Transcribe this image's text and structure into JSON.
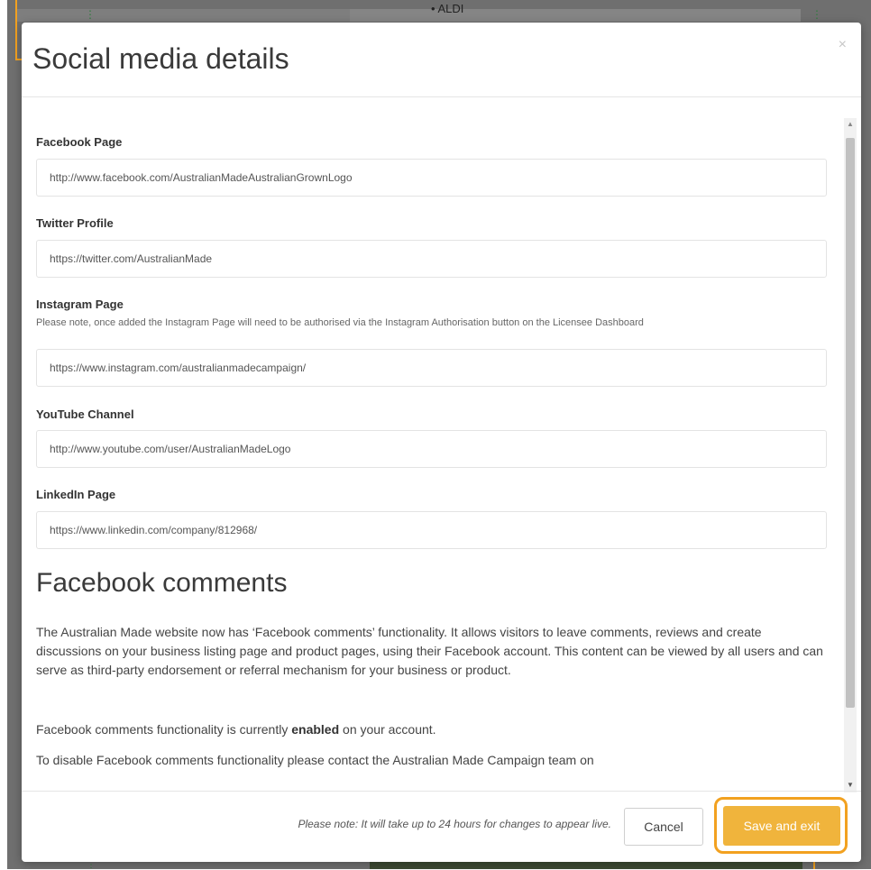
{
  "background": {
    "list_item": "ALDI"
  },
  "modal": {
    "title": "Social media details",
    "close_symbol": "×"
  },
  "fields": [
    {
      "label": "Facebook Page",
      "value": "http://www.facebook.com/AustralianMadeAustralianGrownLogo"
    },
    {
      "label": "Twitter Profile",
      "value": "https://twitter.com/AustralianMade"
    },
    {
      "label": "Instagram Page",
      "note": "Please note, once added the Instagram Page will need to be authorised via the Instagram Authorisation button on the Licensee Dashboard",
      "value": "https://www.instagram.com/australianmadecampaign/"
    },
    {
      "label": "YouTube Channel",
      "value": "http://www.youtube.com/user/AustralianMadeLogo"
    },
    {
      "label": "LinkedIn Page",
      "value": "https://www.linkedin.com/company/812968/"
    }
  ],
  "facebook_comments": {
    "heading": "Facebook comments",
    "description": "The Australian Made website now has ‘Facebook comments’ functionality. It allows visitors to leave comments, reviews and create discussions on your business listing page and product pages, using their Facebook account. This content can be viewed by all users and can serve as third-party endorsement or referral mechanism for your business or product.",
    "status_prefix": "Facebook comments functionality is currently ",
    "status_value": "enabled",
    "status_suffix": " on your account.",
    "disable_text": "To disable Facebook comments functionality please contact the Australian Made Campaign team on"
  },
  "footer": {
    "note": "Please note: It will take up to 24 hours for changes to appear live.",
    "cancel_label": "Cancel",
    "save_label": "Save and exit"
  },
  "colors": {
    "accent": "#f0b43c",
    "annotation": "#f2a120",
    "overlay": "#6f6f6f"
  }
}
